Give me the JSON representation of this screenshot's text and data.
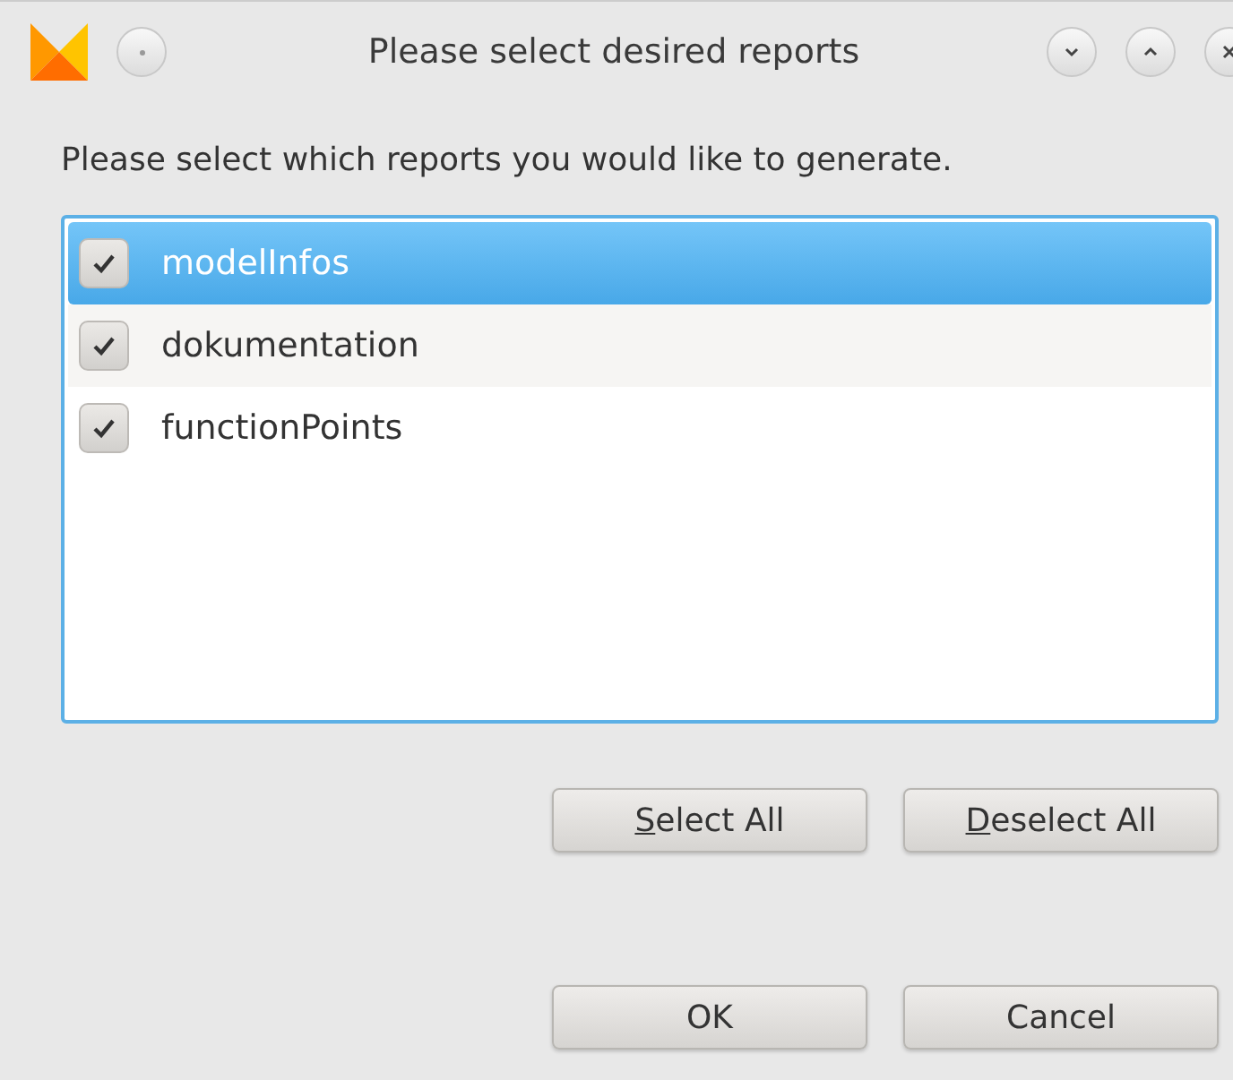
{
  "window": {
    "title": "Please select desired reports"
  },
  "prompt": "Please select which reports you would like to generate.",
  "reports": [
    {
      "label": "modelInfos",
      "checked": true,
      "selected": true
    },
    {
      "label": "dokumentation",
      "checked": true,
      "selected": false
    },
    {
      "label": "functionPoints",
      "checked": true,
      "selected": false
    }
  ],
  "selection_buttons": [
    {
      "label": "Select All",
      "mnemonic_underlined": true
    },
    {
      "label": "Deselect All",
      "mnemonic_underlined": true
    }
  ],
  "dialog_buttons": [
    {
      "label": "OK",
      "mnemonic_underlined": false
    },
    {
      "label": "Cancel",
      "mnemonic_underlined": false
    }
  ]
}
